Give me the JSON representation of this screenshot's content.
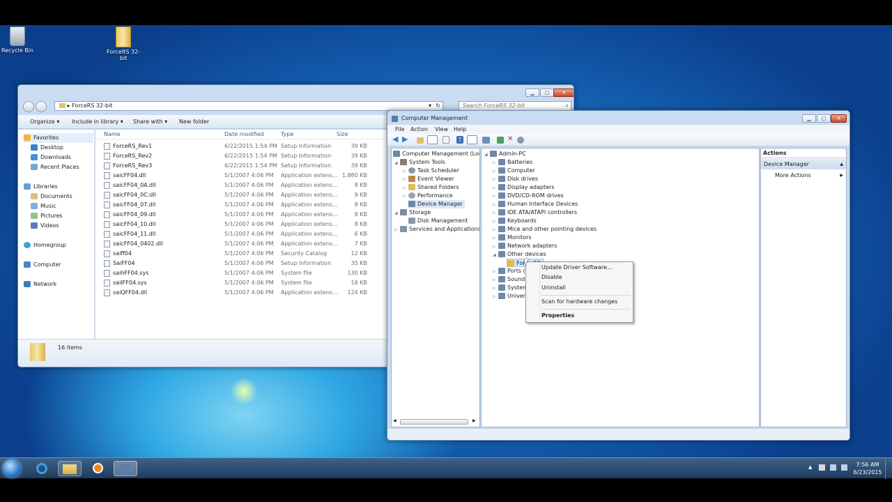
{
  "desktop": {
    "icons": [
      {
        "label": "Recycle Bin"
      },
      {
        "label": "ForceRS 32-bit"
      }
    ]
  },
  "explorer": {
    "address": "ForceRS 32-bit",
    "search_placeholder": "Search ForceRS 32-bit",
    "toolbar": {
      "organize": "Organize",
      "include": "Include in library",
      "share": "Share with",
      "new_folder": "New folder"
    },
    "nav": {
      "favorites": "Favorites",
      "desktop": "Desktop",
      "downloads": "Downloads",
      "recent": "Recent Places",
      "libraries": "Libraries",
      "documents": "Documents",
      "music": "Music",
      "pictures": "Pictures",
      "videos": "Videos",
      "homegroup": "Homegroup",
      "computer": "Computer",
      "network": "Network"
    },
    "columns": {
      "name": "Name",
      "date": "Date modified",
      "type": "Type",
      "size": "Size"
    },
    "files": [
      {
        "name": "ForceRS_Rev1",
        "date": "6/22/2015 1:54 PM",
        "type": "Setup Information",
        "size": "39 KB"
      },
      {
        "name": "ForceRS_Rev2",
        "date": "6/22/2015 1:54 PM",
        "type": "Setup Information",
        "size": "39 KB"
      },
      {
        "name": "ForceRS_Rev3",
        "date": "6/22/2015 1:54 PM",
        "type": "Setup Information",
        "size": "39 KB"
      },
      {
        "name": "saicFF04.dll",
        "date": "5/1/2007 4:06 PM",
        "type": "Application extens...",
        "size": "1,880 KB"
      },
      {
        "name": "saicFF04_0A.dll",
        "date": "5/1/2007 4:06 PM",
        "type": "Application extens...",
        "size": "8 KB"
      },
      {
        "name": "saicFF04_0C.dll",
        "date": "5/1/2007 4:06 PM",
        "type": "Application extens...",
        "size": "9 KB"
      },
      {
        "name": "saicFF04_07.dll",
        "date": "5/1/2007 4:06 PM",
        "type": "Application extens...",
        "size": "8 KB"
      },
      {
        "name": "saicFF04_09.dll",
        "date": "5/1/2007 4:06 PM",
        "type": "Application extens...",
        "size": "8 KB"
      },
      {
        "name": "saicFF04_10.dll",
        "date": "5/1/2007 4:06 PM",
        "type": "Application extens...",
        "size": "8 KB"
      },
      {
        "name": "saicFF04_11.dll",
        "date": "5/1/2007 4:06 PM",
        "type": "Application extens...",
        "size": "6 KB"
      },
      {
        "name": "saicFF04_0402.dll",
        "date": "5/1/2007 4:06 PM",
        "type": "Application extens...",
        "size": "7 KB"
      },
      {
        "name": "saiff04",
        "date": "5/1/2007 4:06 PM",
        "type": "Security Catalog",
        "size": "12 KB"
      },
      {
        "name": "SaiFF04",
        "date": "5/1/2007 4:06 PM",
        "type": "Setup Information",
        "size": "35 KB"
      },
      {
        "name": "saihFF04.sys",
        "date": "5/1/2007 4:06 PM",
        "type": "System file",
        "size": "130 KB"
      },
      {
        "name": "saiIFF04.sys",
        "date": "5/1/2007 4:06 PM",
        "type": "System file",
        "size": "16 KB"
      },
      {
        "name": "saiQFF04.dll",
        "date": "5/1/2007 4:06 PM",
        "type": "Application extens...",
        "size": "124 KB"
      }
    ],
    "status": "16 items"
  },
  "cm": {
    "title": "Computer Management",
    "menu": {
      "file": "File",
      "action": "Action",
      "view": "View",
      "help": "Help"
    },
    "left": {
      "root": "Computer Management (Local",
      "system_tools": "System Tools",
      "task_scheduler": "Task Scheduler",
      "event_viewer": "Event Viewer",
      "shared_folders": "Shared Folders",
      "performance": "Performance",
      "device_manager": "Device Manager",
      "storage": "Storage",
      "disk_management": "Disk Management",
      "services": "Services and Applications"
    },
    "devices": {
      "root": "Admin-PC",
      "items": [
        "Batteries",
        "Computer",
        "Disk drives",
        "Display adapters",
        "DVD/CD-ROM drives",
        "Human Interface Devices",
        "IDE ATA/ATAPI controllers",
        "Keyboards",
        "Mice and other pointing devices",
        "Monitors",
        "Network adapters",
        "Other devices"
      ],
      "child": "Force RS",
      "after": [
        "Ports (",
        "Sound",
        "System",
        "Univer"
      ]
    },
    "actions": {
      "header": "Actions",
      "section": "Device Manager",
      "more": "More Actions"
    },
    "context": {
      "update": "Update Driver Software...",
      "disable": "Disable",
      "uninstall": "Uninstall",
      "scan": "Scan for hardware changes",
      "properties": "Properties"
    }
  },
  "taskbar": {
    "time": "7:56 AM",
    "date": "6/23/2015"
  },
  "colors": {
    "selection": "#cce8ff",
    "taskbar": "#1d3b5e"
  }
}
